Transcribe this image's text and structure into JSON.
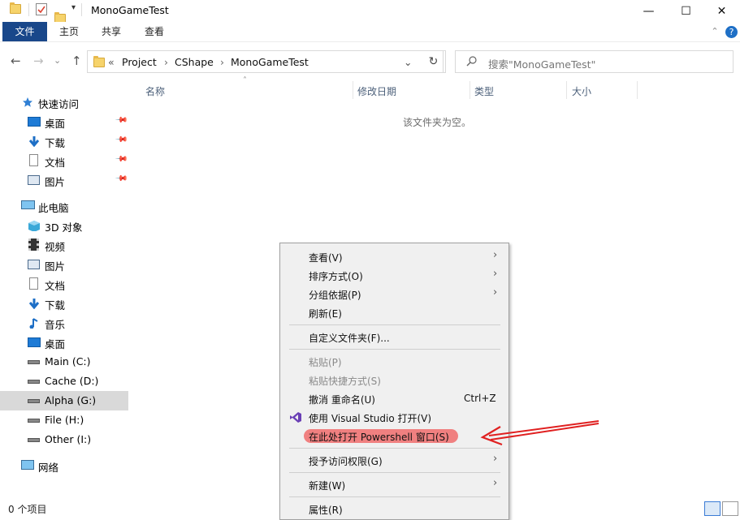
{
  "window": {
    "title": "MonoGameTest",
    "minimize_glyph": "—",
    "maximize_glyph": "☐",
    "close_glyph": "✕",
    "qa_dropdown_glyph": "▾"
  },
  "ribbon": {
    "tabs": [
      "文件",
      "主页",
      "共享",
      "查看"
    ],
    "collapse_glyph": "⌃",
    "help_glyph": "?"
  },
  "address": {
    "back_glyph": "←",
    "forward_glyph": "→",
    "recent_glyph": "⌄",
    "up_glyph": "↑",
    "overflow": "«",
    "crumbs": [
      "Project",
      "CShape",
      "MonoGameTest"
    ],
    "separator": "›",
    "dropdown_glyph": "⌄",
    "refresh_glyph": "↻",
    "search_placeholder": "搜索\"MonoGameTest\""
  },
  "columns": {
    "sort_glyph": "˄",
    "name": "名称",
    "modified": "修改日期",
    "type": "类型",
    "size": "大小"
  },
  "empty_message": "该文件夹为空。",
  "nav": {
    "quick_access": "快速访问",
    "quick_items": [
      "桌面",
      "下载",
      "文档",
      "图片"
    ],
    "pin_glyph": "📌",
    "this_pc": "此电脑",
    "pc_items": [
      "3D 对象",
      "视频",
      "图片",
      "文档",
      "下载",
      "音乐",
      "桌面"
    ],
    "drives": [
      "Main (C:)",
      "Cache (D:)",
      "Alpha (G:)",
      "File (H:)",
      "Other (I:)"
    ],
    "selected_drive_index": 2,
    "network": "网络"
  },
  "status": {
    "item_count": "0 个项目"
  },
  "context_menu": {
    "submenu_glyph": "›",
    "items": {
      "view": "查看(V)",
      "sort": "排序方式(O)",
      "group": "分组依据(P)",
      "refresh": "刷新(E)",
      "customize": "自定义文件夹(F)...",
      "paste": "粘贴(P)",
      "paste_shortcut": "粘贴快捷方式(S)",
      "undo": "撤消 重命名(U)",
      "undo_shortcut": "Ctrl+Z",
      "open_vs": "使用 Visual Studio 打开(V)",
      "open_powershell": "在此处打开 Powershell 窗口(S)",
      "grant_access": "授予访问权限(G)",
      "new": "新建(W)",
      "properties": "属性(R)"
    }
  },
  "colors": {
    "file_tab": "#19478a",
    "accent_blue": "#1e6fc6",
    "highlight": "#f08080",
    "annotation_red": "#e02020",
    "vs_purple": "#6a3fb5"
  }
}
